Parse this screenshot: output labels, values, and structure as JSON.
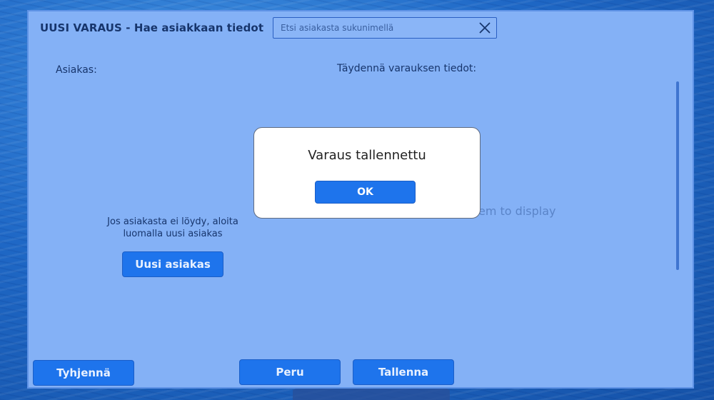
{
  "header": {
    "title": "UUSI VARAUS - Hae asiakkaan tiedot",
    "search_placeholder": "Etsi asiakasta sukunimellä"
  },
  "left": {
    "customer_label": "Asiakas:",
    "hint_text": "Jos asiakasta ei löydy, aloita luomalla uusi asiakas",
    "new_customer_button": "Uusi asiakas"
  },
  "right": {
    "details_label": "Täydennä varauksen tiedot:",
    "empty_message": "em to display"
  },
  "footer": {
    "clear_button": "Tyhjennä",
    "cancel_button": "Peru",
    "save_button": "Tallenna"
  },
  "dialog": {
    "message": "Varaus tallennettu",
    "ok_button": "OK"
  },
  "colors": {
    "panel": "#84b1f6",
    "button": "#1e74ec",
    "title_text": "#17356c"
  },
  "icons": {
    "search_clear": "close-icon"
  }
}
